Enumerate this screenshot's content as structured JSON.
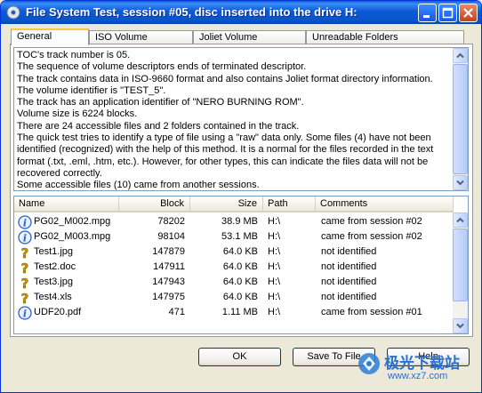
{
  "window": {
    "title": "File System Test, session #05, disc inserted into the drive H:"
  },
  "tabs": [
    {
      "label": "General",
      "active": true
    },
    {
      "label": "ISO Volume",
      "active": false
    },
    {
      "label": "Joliet Volume",
      "active": false
    },
    {
      "label": "Unreadable Folders",
      "active": false
    }
  ],
  "info_lines": [
    "TOC's track number is 05.",
    "The sequence of volume descriptors ends of terminated descriptor.",
    "The track contains data in ISO-9660 format and also contains Joliet format directory information.",
    "The volume identifier is \"TEST_5\".",
    "The track has an application identifier of \"NERO BURNING ROM\".",
    "Volume size is 6224 blocks.",
    "There are 24 accessible files and 2 folders contained in the track.",
    "The quick test tries to identify a type of file using a \"raw\" data only. Some files (4) have not been",
    "identified (recognized) with the help of this method. It is a normal for the files recorded in the text",
    "format (.txt, .eml, .htm, etc.). However, for other types, this can indicate the files data will not be",
    "recovered correctly.",
    "Some accessible files (10) came from another sessions."
  ],
  "file_list": {
    "columns": [
      "Name",
      "Block",
      "Size",
      "Path",
      "Comments"
    ],
    "rows": [
      {
        "icon": "info-icon",
        "name": "PG02_M002.mpg",
        "block": "78202",
        "size": "38.9 MB",
        "path": "H:\\",
        "comment": "came from session #02"
      },
      {
        "icon": "info-icon",
        "name": "PG02_M003.mpg",
        "block": "98104",
        "size": "53.1 MB",
        "path": "H:\\",
        "comment": "came from session #02"
      },
      {
        "icon": "question-icon",
        "name": "Test1.jpg",
        "block": "147879",
        "size": "64.0 KB",
        "path": "H:\\",
        "comment": "not identified"
      },
      {
        "icon": "question-icon",
        "name": "Test2.doc",
        "block": "147911",
        "size": "64.0 KB",
        "path": "H:\\",
        "comment": "not identified"
      },
      {
        "icon": "question-icon",
        "name": "Test3.jpg",
        "block": "147943",
        "size": "64.0 KB",
        "path": "H:\\",
        "comment": "not identified"
      },
      {
        "icon": "question-icon",
        "name": "Test4.xls",
        "block": "147975",
        "size": "64.0 KB",
        "path": "H:\\",
        "comment": "not identified"
      },
      {
        "icon": "info-icon",
        "name": "UDF20.pdf",
        "block": "471",
        "size": "1.11 MB",
        "path": "H:\\",
        "comment": "came from session #01"
      }
    ]
  },
  "buttons": {
    "ok": "OK",
    "save": "Save To File",
    "help": "Help"
  },
  "watermark": {
    "text_cn": "极光下载站",
    "url": "www.xz7.com"
  },
  "colors": {
    "titlebar": "#0a54cc",
    "tab_highlight": "#ffc83c",
    "info_icon": "#2a63c9",
    "question_icon": "#c89b00"
  }
}
